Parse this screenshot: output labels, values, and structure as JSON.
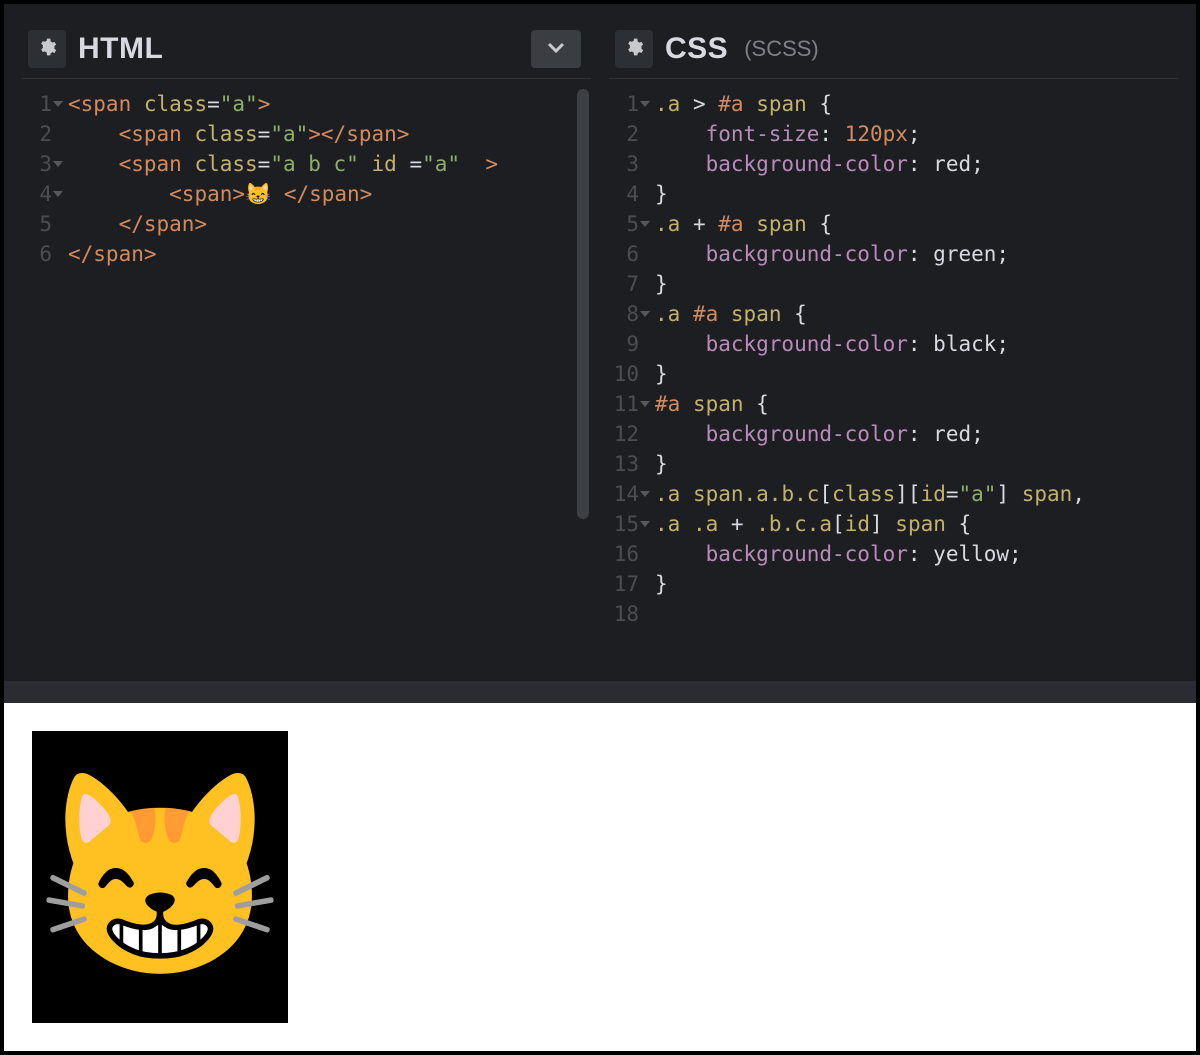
{
  "panels": {
    "html": {
      "title": "HTML",
      "subtitle": "",
      "has_chevron": true,
      "gutter": [
        "1",
        "2",
        "3",
        "4",
        "5",
        "6"
      ],
      "folds": [
        0,
        2,
        3
      ],
      "code_lines": [
        [
          [
            "tag",
            "<span"
          ],
          [
            "punct",
            " "
          ],
          [
            "attr",
            "class"
          ],
          [
            "punct",
            "="
          ],
          [
            "str",
            "\"a\""
          ],
          [
            "tag",
            ">"
          ]
        ],
        [
          [
            "punct",
            "    "
          ],
          [
            "tag",
            "<span"
          ],
          [
            "punct",
            " "
          ],
          [
            "attr",
            "class"
          ],
          [
            "punct",
            "="
          ],
          [
            "str",
            "\"a\""
          ],
          [
            "tag",
            "></span>"
          ]
        ],
        [
          [
            "punct",
            "    "
          ],
          [
            "tag",
            "<span"
          ],
          [
            "punct",
            " "
          ],
          [
            "attr",
            "class"
          ],
          [
            "punct",
            "="
          ],
          [
            "str",
            "\"a b c\""
          ],
          [
            "punct",
            " "
          ],
          [
            "attr",
            "id"
          ],
          [
            "punct",
            " ="
          ],
          [
            "str",
            "\"a\""
          ],
          [
            "punct",
            " "
          ],
          [
            "tag",
            " >"
          ]
        ],
        [
          [
            "punct",
            "        "
          ],
          [
            "tag",
            "<span>"
          ],
          [
            "punct",
            "😸 "
          ],
          [
            "tag",
            "</span>"
          ]
        ],
        [
          [
            "punct",
            "    "
          ],
          [
            "tag",
            "</span>"
          ]
        ],
        [
          [
            "tag",
            "</span>"
          ]
        ]
      ]
    },
    "css": {
      "title": "CSS",
      "subtitle": "(SCSS)",
      "has_chevron": false,
      "gutter": [
        "1",
        "2",
        "3",
        "4",
        "5",
        "6",
        "7",
        "8",
        "9",
        "10",
        "11",
        "12",
        "13",
        "14",
        "15",
        "16",
        "17",
        "18"
      ],
      "folds": [
        0,
        4,
        7,
        10,
        13,
        14
      ],
      "code_lines": [
        [
          [
            "sel",
            ".a"
          ],
          [
            "punct",
            " > "
          ],
          [
            "sel-id",
            "#a"
          ],
          [
            "punct",
            " "
          ],
          [
            "sel",
            "span"
          ],
          [
            "punct",
            " {"
          ]
        ],
        [
          [
            "punct",
            "    "
          ],
          [
            "prop",
            "font-size"
          ],
          [
            "punct",
            ": "
          ],
          [
            "num",
            "120px"
          ],
          [
            "punct",
            ";"
          ]
        ],
        [
          [
            "punct",
            "    "
          ],
          [
            "prop",
            "background-color"
          ],
          [
            "punct",
            ": "
          ],
          [
            "kw",
            "red"
          ],
          [
            "punct",
            ";"
          ]
        ],
        [
          [
            "punct",
            "}"
          ]
        ],
        [
          [
            "sel",
            ".a"
          ],
          [
            "punct",
            " + "
          ],
          [
            "sel-id",
            "#a"
          ],
          [
            "punct",
            " "
          ],
          [
            "sel",
            "span"
          ],
          [
            "punct",
            " {"
          ]
        ],
        [
          [
            "punct",
            "    "
          ],
          [
            "prop",
            "background-color"
          ],
          [
            "punct",
            ": "
          ],
          [
            "kw",
            "green"
          ],
          [
            "punct",
            ";"
          ]
        ],
        [
          [
            "punct",
            "}"
          ]
        ],
        [
          [
            "sel",
            ".a"
          ],
          [
            "punct",
            " "
          ],
          [
            "sel-id",
            "#a"
          ],
          [
            "punct",
            " "
          ],
          [
            "sel",
            "span"
          ],
          [
            "punct",
            " {"
          ]
        ],
        [
          [
            "punct",
            "    "
          ],
          [
            "prop",
            "background-color"
          ],
          [
            "punct",
            ": "
          ],
          [
            "kw",
            "black"
          ],
          [
            "punct",
            ";"
          ]
        ],
        [
          [
            "punct",
            "}"
          ]
        ],
        [
          [
            "sel-id",
            "#a"
          ],
          [
            "punct",
            " "
          ],
          [
            "sel",
            "span"
          ],
          [
            "punct",
            " {"
          ]
        ],
        [
          [
            "punct",
            "    "
          ],
          [
            "prop",
            "background-color"
          ],
          [
            "punct",
            ": "
          ],
          [
            "kw",
            "red"
          ],
          [
            "punct",
            ";"
          ]
        ],
        [
          [
            "punct",
            "}"
          ]
        ],
        [
          [
            "sel",
            ".a"
          ],
          [
            "punct",
            " "
          ],
          [
            "sel",
            "span.a.b.c"
          ],
          [
            "punct",
            "["
          ],
          [
            "sel",
            "class"
          ],
          [
            "punct",
            "]["
          ],
          [
            "sel",
            "id"
          ],
          [
            "punct",
            "="
          ],
          [
            "str",
            "\"a\""
          ],
          [
            "punct",
            "] "
          ],
          [
            "sel",
            "span"
          ],
          [
            "punct",
            ","
          ]
        ],
        [
          [
            "sel",
            ".a"
          ],
          [
            "punct",
            " "
          ],
          [
            "sel",
            ".a"
          ],
          [
            "punct",
            " + "
          ],
          [
            "sel",
            ".b.c.a"
          ],
          [
            "punct",
            "["
          ],
          [
            "sel",
            "id"
          ],
          [
            "punct",
            "] "
          ],
          [
            "sel",
            "span"
          ],
          [
            "punct",
            " {"
          ]
        ],
        [
          [
            "punct",
            "    "
          ],
          [
            "prop",
            "background-color"
          ],
          [
            "punct",
            ": "
          ],
          [
            "kw",
            "yellow"
          ],
          [
            "punct",
            ";"
          ]
        ],
        [
          [
            "punct",
            "}"
          ]
        ],
        [
          [
            "punct",
            ""
          ]
        ]
      ]
    }
  },
  "preview": {
    "emoji": "😸"
  }
}
